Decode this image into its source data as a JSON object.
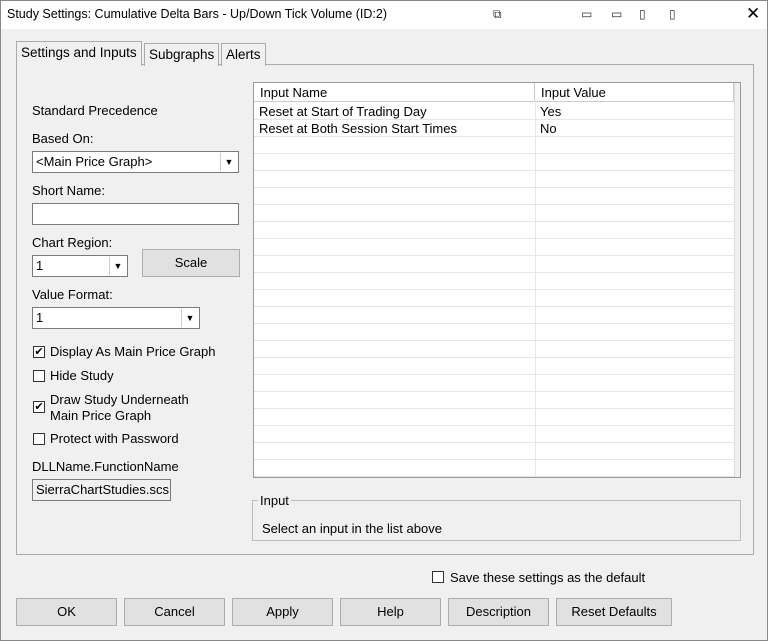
{
  "title": "Study Settings: Cumulative Delta Bars - Up/Down Tick Volume (ID:2)",
  "tabs": [
    "Settings and Inputs",
    "Subgraphs",
    "Alerts"
  ],
  "left": {
    "standard_precedence": "Standard Precedence",
    "based_on_label": "Based On:",
    "based_on_value": "<Main Price Graph>",
    "short_name_label": "Short Name:",
    "short_name_value": "",
    "chart_region_label": "Chart Region:",
    "chart_region_value": "1",
    "scale_button": "Scale",
    "value_format_label": "Value Format:",
    "value_format_value": "1",
    "checkboxes": [
      {
        "label": "Display As Main Price Graph",
        "checked": true
      },
      {
        "label": "Hide Study",
        "checked": false
      },
      {
        "label": "Draw Study Underneath",
        "label2": "Main Price Graph",
        "checked": true
      },
      {
        "label": "Protect with Password",
        "checked": false
      }
    ],
    "dll_label": "DLLName.FunctionName",
    "dll_value": "SierraChartStudies.scs"
  },
  "grid": {
    "headers": [
      "Input Name",
      "Input Value"
    ],
    "rows": [
      {
        "name": "Reset at Start of Trading Day",
        "value": "Yes"
      },
      {
        "name": "Reset at Both Session Start Times",
        "value": "No"
      }
    ]
  },
  "input_box": {
    "title": "Input",
    "text": "Select an input in the list above"
  },
  "save_default": {
    "label": "Save these settings as the default",
    "checked": false
  },
  "buttons": [
    "OK",
    "Cancel",
    "Apply",
    "Help",
    "Description",
    "Reset Defaults"
  ]
}
